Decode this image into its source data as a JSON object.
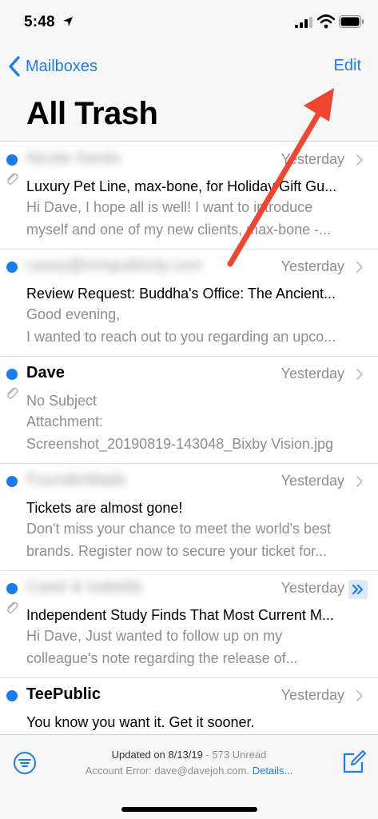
{
  "status_bar": {
    "time": "5:48"
  },
  "nav": {
    "back_label": "Mailboxes",
    "edit_label": "Edit",
    "title": "All Trash"
  },
  "messages": [
    {
      "sender": "Nicole Sands",
      "date": "Yesterday",
      "subject": "Luxury Pet Line, max-bone, for Holiday Gift Gu...",
      "preview1": "Hi Dave, I hope all is well! I want to introduce",
      "preview2": "myself and one of my new clients, max-bone -..."
    },
    {
      "sender": "casey@mmpublicity.com",
      "date": "Yesterday",
      "subject": "Review Request: Buddha's Office: The Ancient...",
      "preview1": "Good evening,",
      "preview2": "I wanted to reach out to you regarding an upco..."
    },
    {
      "sender": "Dave",
      "date": "Yesterday",
      "subject": "No Subject",
      "preview1": "Attachment:",
      "preview2": "Screenshot_20190819-143048_Bixby Vision.jpg"
    },
    {
      "sender": "FounderMade",
      "date": "Yesterday",
      "subject": "Tickets are almost gone!",
      "preview1": "Don't miss your chance to meet the world's best",
      "preview2": "brands. Register now to secure your ticket for..."
    },
    {
      "sender": "Casei & Isabella",
      "date": "Yesterday",
      "subject": "Independent Study Finds That Most Current M...",
      "preview1": "Hi Dave, Just wanted to follow up on my",
      "preview2": "colleague's note regarding the release of..."
    },
    {
      "sender": "TeePublic",
      "date": "Yesterday",
      "subject": "You know you want it. Get it sooner."
    }
  ],
  "toolbar": {
    "updated_prefix": "Updated on 8/13/19",
    "unread_text": " - 573 Unread",
    "error_text": "Account Error: dave@davejoh.com. ",
    "details_link": "Details..."
  },
  "colors": {
    "accent": "#1a7cf4",
    "annotation": "#f0452e",
    "secondary_text": "#8e8e93"
  },
  "icons": [
    "location-arrow-icon",
    "signal-icon",
    "wifi-icon",
    "battery-icon",
    "chevron-left-icon",
    "paperclip-icon",
    "chevron-right-icon",
    "thread-icon",
    "filter-icon",
    "compose-icon"
  ]
}
